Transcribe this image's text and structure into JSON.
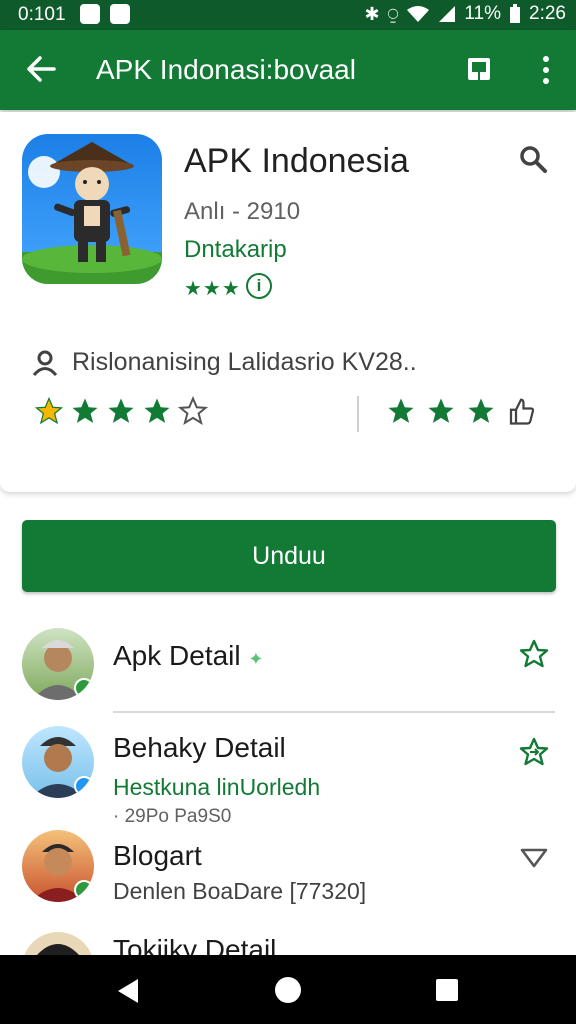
{
  "status_bar": {
    "time": "0:101",
    "battery": "11%",
    "clock": "2:26"
  },
  "app_bar": {
    "title": "APK Indonasi:bovaal",
    "icons": [
      "back-arrow-icon",
      "book-icon",
      "more-vert-icon"
    ]
  },
  "app": {
    "name": "APK Indonesia",
    "version": "Anlı - 2910",
    "developer": "Dntakarip",
    "stars_text": "★★★",
    "info_glyph": "i"
  },
  "reviewer": {
    "text": "Rislonanising Lalidasrio KV28.."
  },
  "ratings": {
    "left": [
      "filled-yellow",
      "filled",
      "filled",
      "filled",
      "outline"
    ],
    "right": [
      "filled",
      "filled",
      "filled",
      "thumb-outline"
    ]
  },
  "download_button": {
    "label": "Unduu"
  },
  "list": [
    {
      "title": "Apk Detail",
      "title_suffix": "✦",
      "subtitle": "",
      "meta": "",
      "action_icon": "star-outline-icon"
    },
    {
      "title": "Behaky Detail",
      "subtitle": "Hestkuna linUorledh",
      "meta": "· 29Po Pa9S0",
      "action_icon": "star-arrow-icon"
    },
    {
      "title": "Blogart",
      "subtitle": "Denlen BoaDare [77320]",
      "meta": "",
      "action_icon": "triangle-down-icon"
    },
    {
      "title": "Tokiiky Detail",
      "subtitle": "",
      "meta": "",
      "action_icon": ""
    }
  ],
  "colors": {
    "status_bar": "#0e5a2a",
    "app_bar": "#127a35",
    "accent": "#127a35",
    "star_yellow": "#f5b800"
  },
  "nav": {
    "icons": [
      "nav-back-icon",
      "nav-home-icon",
      "nav-recents-icon"
    ]
  }
}
